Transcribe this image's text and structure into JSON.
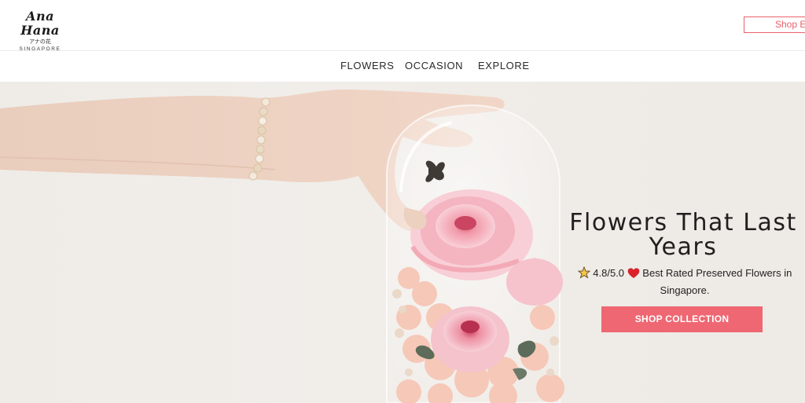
{
  "header": {
    "logo_script": "Ana Hana",
    "logo_japanese": "アナの花",
    "logo_city": "SINGAPORE",
    "shop_button": "Shop E"
  },
  "nav": {
    "items": [
      {
        "label": "FLOWERS"
      },
      {
        "label": "OCCASION"
      },
      {
        "label": "EXPLORE"
      }
    ]
  },
  "hero": {
    "title_line1": "Flowers That Last",
    "title_line2": "Years",
    "rating": "4.8/5.0",
    "rating_text": "Best Rated Preserved Flowers in",
    "rating_text2": "Singapore.",
    "cta_label": "SHOP COLLECTION",
    "star_icon": "star-icon",
    "heart_icon": "heart-icon"
  },
  "colors": {
    "accent": "#ee6772",
    "text": "#1f1f1f",
    "hero_bg": "#efece8"
  }
}
